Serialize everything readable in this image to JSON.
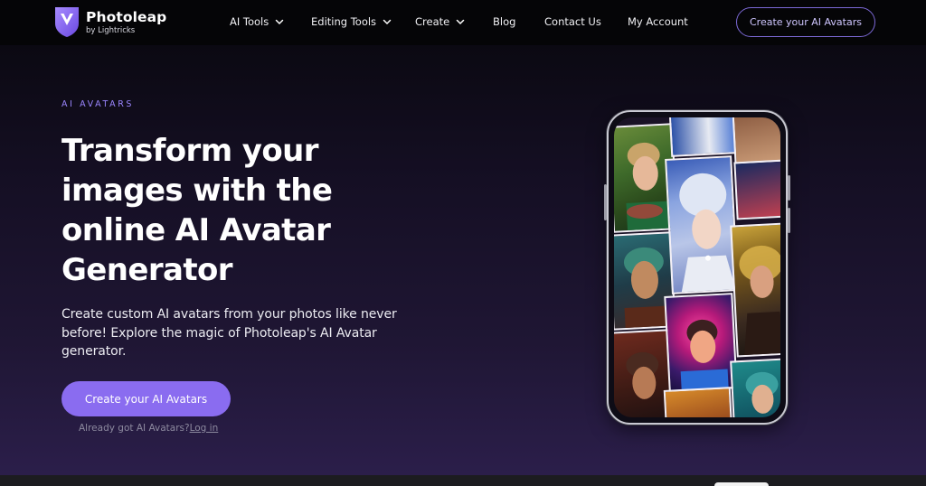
{
  "brand": {
    "name": "Photoleap",
    "byline": "by Lightricks"
  },
  "nav": {
    "items": [
      {
        "label": "AI Tools",
        "has_dropdown": true
      },
      {
        "label": "Editing Tools",
        "has_dropdown": true
      },
      {
        "label": "Create",
        "has_dropdown": true
      },
      {
        "label": "Blog",
        "has_dropdown": false
      },
      {
        "label": "Contact Us",
        "has_dropdown": false
      },
      {
        "label": "My Account",
        "has_dropdown": false
      }
    ],
    "cta_label": "Create your AI Avatars"
  },
  "hero": {
    "eyebrow": "AI AVATARS",
    "headline_lines": [
      "Transform your",
      "images with the",
      "online AI Avatar",
      "Generator"
    ],
    "description_lines": [
      "Create custom AI avatars from your photos like never",
      "before! Explore the magic of Photoleap's AI Avatar",
      "generator."
    ],
    "cta_label": "Create your AI Avatars",
    "login_prompt": "Already got AI Avatars?",
    "login_link": "Log in"
  },
  "colors": {
    "accent": "#8a6cf0",
    "eyebrow": "#9b86ff",
    "nav_cta_border": "#7c69d6",
    "background_top": "#050507",
    "background_bottom": "#2b1e4a"
  },
  "icons": {
    "logo": "photoleap-logo-icon",
    "dropdown": "chevron-down-icon"
  }
}
